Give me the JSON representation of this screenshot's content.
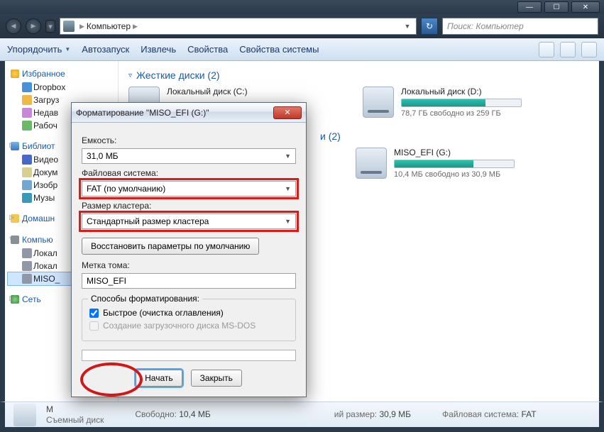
{
  "titlebar": {
    "min": "—",
    "max": "☐",
    "close": "✕"
  },
  "address": {
    "location": "Компьютер",
    "search_placeholder": "Поиск: Компьютер"
  },
  "toolbar": {
    "organize": "Упорядочить",
    "autoplay": "Автозапуск",
    "eject": "Извлечь",
    "properties": "Свойства",
    "sysprops": "Свойства системы"
  },
  "sidebar": {
    "favorites": {
      "title": "Избранное",
      "items": [
        "Dropbox",
        "Загруз",
        "Недав",
        "Рабоч"
      ]
    },
    "libraries": {
      "title": "Библиот",
      "items": [
        "Видео",
        "Докум",
        "Изобр",
        "Музы"
      ]
    },
    "homegroup": {
      "title": "Домашн"
    },
    "computer": {
      "title": "Компью",
      "items": [
        "Локал",
        "Локал",
        "MISO_"
      ]
    },
    "network": {
      "title": "Сеть"
    }
  },
  "section_hdd": "Жесткие диски (2)",
  "section_removable_suffix": "и (2)",
  "drives": {
    "c": {
      "name": "Локальный диск (C:)"
    },
    "d": {
      "name": "Локальный диск (D:)",
      "sub": "78,7 ГБ свободно из 259 ГБ",
      "fill": 70
    },
    "g": {
      "name": "MISO_EFI (G:)",
      "sub": "10,4 МБ свободно из 30,9 МБ",
      "fill": 66
    }
  },
  "footer": {
    "name": "M",
    "type": "Съемный диск",
    "free_lab": "Свободно:",
    "free_val": "10,4 МБ",
    "size_lab": "ий размер:",
    "size_val": "30,9 МБ",
    "fs_lab": "Файловая система:",
    "fs_val": "FAT"
  },
  "dialog": {
    "title": "Форматирование \"MISO_EFI (G:)\"",
    "capacity_label": "Емкость:",
    "capacity_value": "31,0 МБ",
    "fs_label": "Файловая система:",
    "fs_value": "FAT (по умолчанию)",
    "cluster_label": "Размер кластера:",
    "cluster_value": "Стандартный размер кластера",
    "restore_btn": "Восстановить параметры по умолчанию",
    "volume_label": "Метка тома:",
    "volume_value": "MISO_EFI",
    "methods_title": "Способы форматирования:",
    "quick": "Быстрое (очистка оглавления)",
    "msdos": "Создание загрузочного диска MS-DOS",
    "start": "Начать",
    "close": "Закрыть"
  }
}
